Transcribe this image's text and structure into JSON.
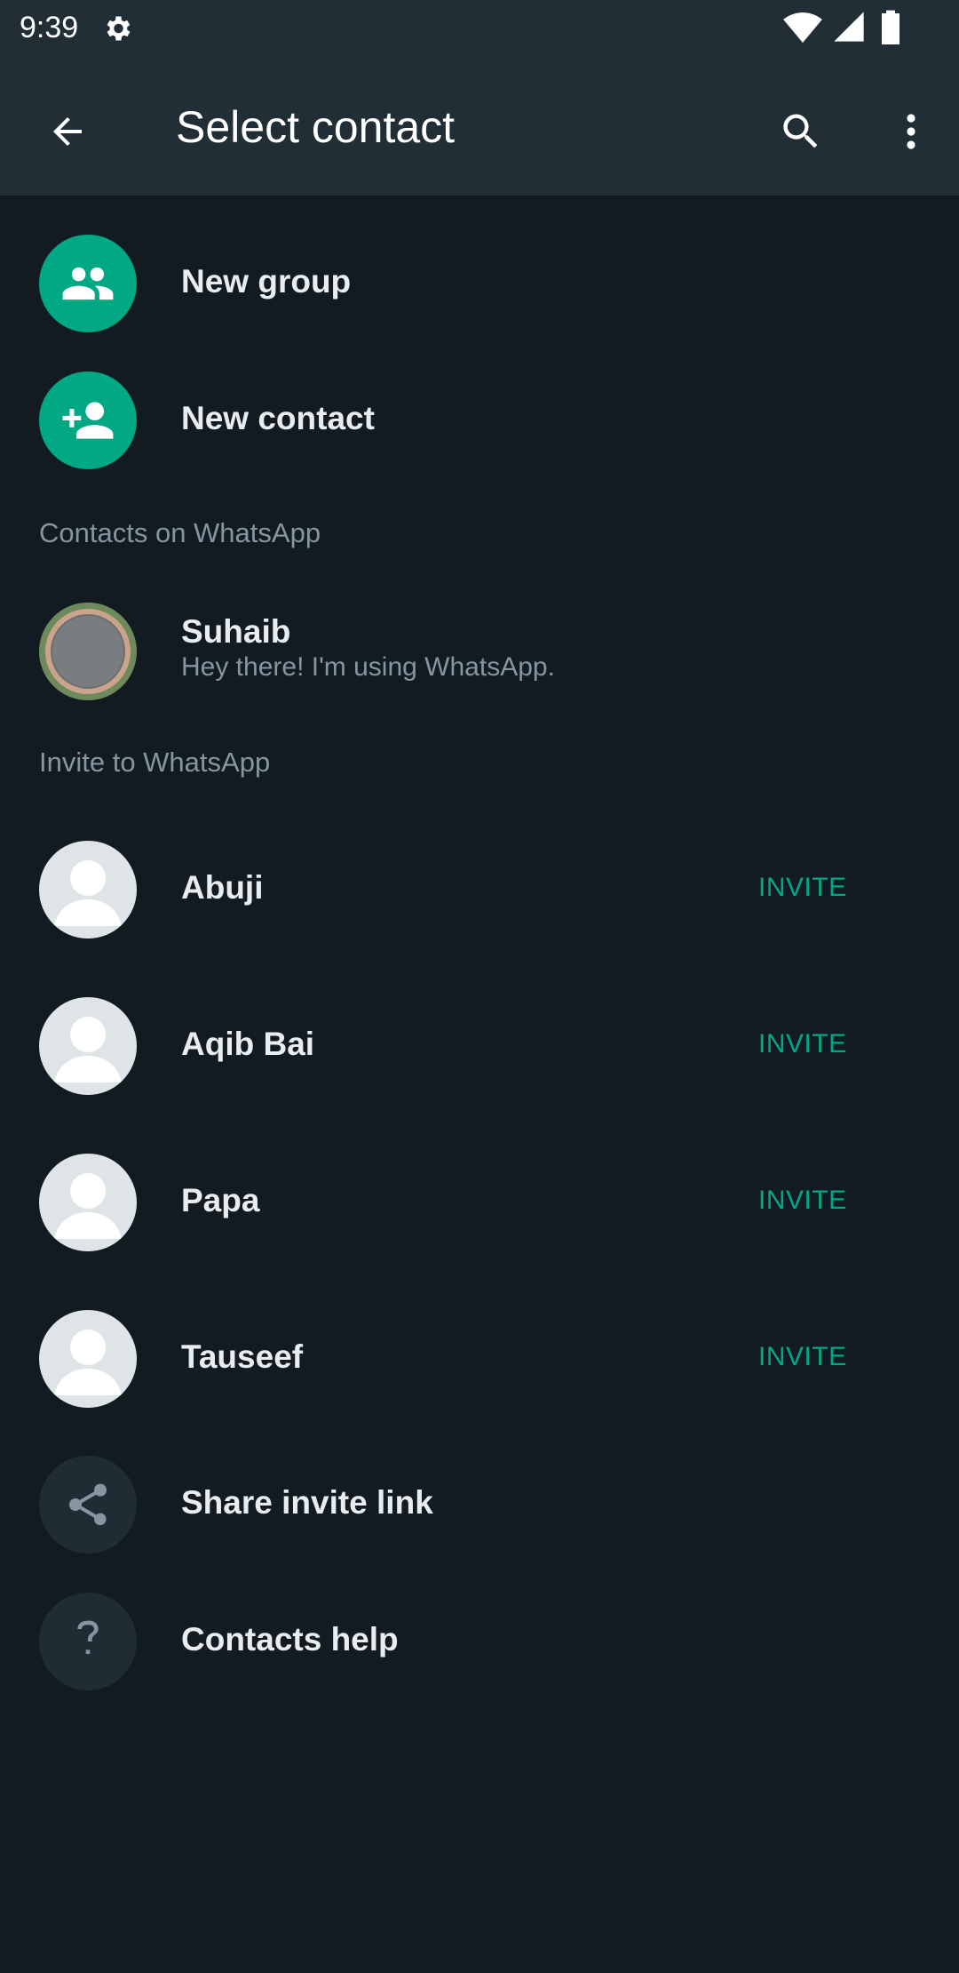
{
  "status_bar": {
    "time": "9:39"
  },
  "header": {
    "title": "Select contact"
  },
  "actions": [
    {
      "label": "New group",
      "icon": "group-icon"
    },
    {
      "label": "New contact",
      "icon": "add-person-icon"
    }
  ],
  "sections": {
    "on_whatsapp": "Contacts on WhatsApp",
    "invite": "Invite to WhatsApp"
  },
  "contacts_on_whatsapp": [
    {
      "name": "Suhaib",
      "status": "Hey there! I'm using WhatsApp."
    }
  ],
  "invite_contacts": [
    {
      "name": "Abuji",
      "action": "INVITE"
    },
    {
      "name": "Aqib Bai",
      "action": "INVITE"
    },
    {
      "name": "Papa",
      "action": "INVITE"
    },
    {
      "name": "Tauseef",
      "action": "INVITE"
    }
  ],
  "footer_items": [
    {
      "label": "Share invite link",
      "icon": "share-icon"
    },
    {
      "label": "Contacts help",
      "icon": "help-icon"
    }
  ],
  "colors": {
    "accent": "#00a884",
    "background": "#121b22",
    "appbar": "#222e35",
    "secondary_text": "#8696a0"
  }
}
